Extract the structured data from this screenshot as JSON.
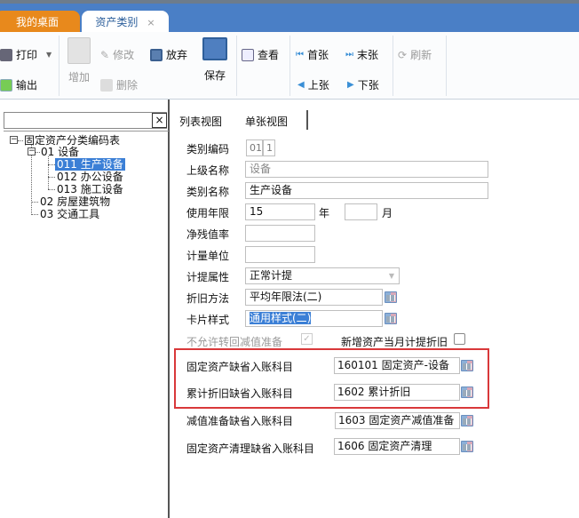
{
  "tabs": [
    {
      "label": "我的桌面"
    },
    {
      "label": "资产类别",
      "close": "×"
    }
  ],
  "toolbar": {
    "print": "打印",
    "export": "输出",
    "add": "增加",
    "edit": "修改",
    "discard": "放弃",
    "delete": "删除",
    "save": "保存",
    "view": "查看",
    "first": "首张",
    "last": "末张",
    "prev": "上张",
    "next": "下张",
    "refresh": "刷新"
  },
  "left": {
    "search_value": "",
    "clear": "×",
    "tree": {
      "root": "固定资产分类编码表",
      "n01": "01 设备",
      "n011": "011 生产设备",
      "n012": "012 办公设备",
      "n013": "013 施工设备",
      "n02": "02 房屋建筑物",
      "n03": "03 交通工具"
    }
  },
  "view_tabs": {
    "list": "列表视图",
    "single": "单张视图"
  },
  "form": {
    "code_label": "类别编码",
    "code_1": "01",
    "code_2": "1",
    "parent_label": "上级名称",
    "parent_value": "设备",
    "name_label": "类别名称",
    "name_value": "生产设备",
    "life_label": "使用年限",
    "life_years": "15",
    "year_unit": "年",
    "life_months": "",
    "month_unit": "月",
    "residual_label": "净残值率",
    "residual_value": "",
    "unit_label": "计量单位",
    "unit_value": "",
    "accrual_label": "计提属性",
    "accrual_value": "正常计提",
    "method_label": "折旧方法",
    "method_value": "平均年限法(二)",
    "card_label": "卡片样式",
    "card_value": "通用样式(二)",
    "no_reverse_label": "不允许转回减值准备",
    "no_reverse_checked": true,
    "new_month_label": "新增资产当月计提折旧",
    "new_month_checked": false,
    "asset_acct_label": "固定资产缺省入账科目",
    "asset_acct_value": "160101 固定资产-设备",
    "dep_acct_label": "累计折旧缺省入账科目",
    "dep_acct_value": "1602 累计折旧",
    "impair_acct_label": "减值准备缺省入账科目",
    "impair_acct_value": "1603 固定资产减值准备",
    "clear_acct_label": "固定资产清理缺省入账科目",
    "clear_acct_value": "1606 固定资产清理"
  },
  "colors": {
    "tab_active_bg": "#ffffff",
    "tab_home": "#e8891c",
    "tabbar": "#4a7fc6",
    "highlight": "#d9383a",
    "selection": "#3b7fd6"
  }
}
